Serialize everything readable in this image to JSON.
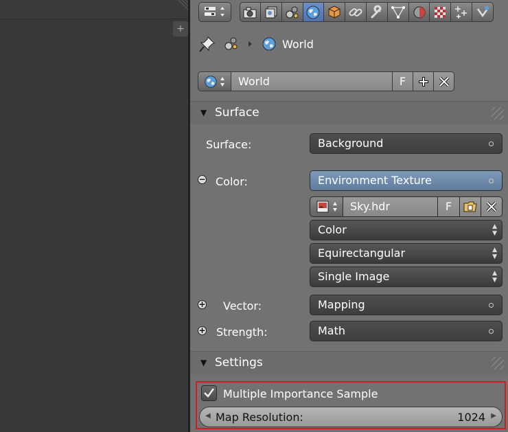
{
  "left_area": {
    "add_symbol": "+"
  },
  "breadcrumb": {
    "world_label": "World"
  },
  "world_datablock": {
    "name": "World",
    "fake_user": "F"
  },
  "surface_panel": {
    "title": "Surface",
    "surface_label": "Surface:",
    "surface_value": "Background",
    "color_label": "Color:",
    "color_value": "Environment Texture",
    "image_name": "Sky.hdr",
    "image_fake_user": "F",
    "color_space": "Color",
    "projection": "Equirectangular",
    "source": "Single Image",
    "vector_label": "Vector:",
    "vector_value": "Mapping",
    "strength_label": "Strength:",
    "strength_value": "Math"
  },
  "settings_panel": {
    "title": "Settings",
    "mis_label": "Multiple Importance Sample",
    "mis_checked": true,
    "map_resolution_label": "Map Resolution:",
    "map_resolution_value": "1024"
  },
  "colors": {
    "highlight": "#cc1f1f",
    "active_tab": "#5b7db5",
    "node_blue": "#6d88a8"
  }
}
